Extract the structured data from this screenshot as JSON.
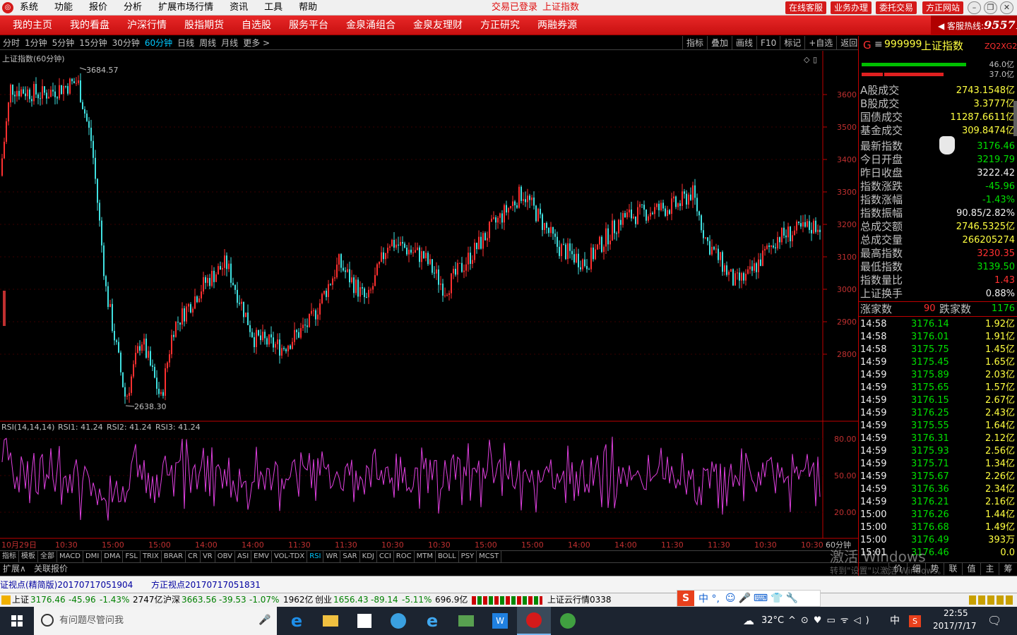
{
  "titlebar": {
    "menu": [
      "系统",
      "功能",
      "报价",
      "分析",
      "扩展市场行情",
      "资讯",
      "工具",
      "帮助"
    ],
    "login_status": "交易已登录",
    "current_view": "上证指数",
    "buttons": [
      "在线客服",
      "业务办理",
      "委托交易",
      "方正网站"
    ],
    "window_controls": [
      "minimize-icon",
      "restore-icon",
      "maximize-icon",
      "close-icon"
    ]
  },
  "nav": {
    "items": [
      "我的主页",
      "我的看盘",
      "沪深行情",
      "股指期货",
      "自选股",
      "服务平台",
      "金泉涌组合",
      "金泉友理财",
      "方正研究",
      "两融券源"
    ],
    "hotline_label": "客服热线:",
    "hotline_number": "95571"
  },
  "periodbar": {
    "periods": [
      "分时",
      "1分钟",
      "5分钟",
      "15分钟",
      "30分钟",
      "60分钟",
      "日线",
      "周线",
      "月线",
      "更多 >"
    ],
    "active": "60分钟",
    "tools": [
      "指标",
      "叠加",
      "画线",
      "F10",
      "标记",
      "+自选",
      "返回"
    ]
  },
  "main_chart": {
    "title": "上证指数(60分钟)",
    "high_label": "3684.57",
    "low_label": "2638.30",
    "y_ticks": [
      "3600",
      "3500",
      "3400",
      "3300",
      "3200",
      "3100",
      "3000",
      "2900",
      "2800"
    ]
  },
  "rsi": {
    "title": "RSI(14,14,14)",
    "rsi1": "RSI1: 41.24",
    "rsi2": "RSI2: 41.24",
    "rsi3": "RSI3: 41.24",
    "y_ticks": [
      "80.00",
      "50.00",
      "20.00"
    ]
  },
  "x_axis": {
    "labels": [
      "10月29日",
      "10:30",
      "15:00",
      "15:00",
      "14:00",
      "14:00",
      "11:30",
      "11:30",
      "10:30",
      "10:30",
      "15:00",
      "15:00",
      "14:00",
      "14:00",
      "11:30",
      "11:30",
      "10:30",
      "10:30"
    ],
    "unit": "60分钟"
  },
  "chart_data": {
    "type": "candlestick",
    "series": [
      {
        "name": "上证指数(60分钟)",
        "y_range": [
          2638.3,
          3684.57
        ],
        "last": 3176.46
      },
      {
        "name": "RSI1",
        "last": 41.24
      }
    ]
  },
  "indicator_tabs": [
    "指标",
    "模板",
    "全部",
    "MACD",
    "DMI",
    "DMA",
    "FSL",
    "TRIX",
    "BRAR",
    "CR",
    "VR",
    "OBV",
    "ASI",
    "EMV",
    "VOL-TDX",
    "RSI",
    "WR",
    "SAR",
    "KDJ",
    "CCI",
    "ROC",
    "MTM",
    "BOLL",
    "PSY",
    "MCST"
  ],
  "active_indicator": "RSI",
  "extbar": {
    "expand": "扩展∧",
    "related": "关联报价"
  },
  "right_panel": {
    "logo": "G",
    "code": "999999",
    "name": "上证指数",
    "tag": "ZQ2XG2",
    "bar_green_pct": "46.0亿",
    "bar_red_pct": "37.0亿",
    "turnover": [
      {
        "k": "A股成交",
        "v": "2743.1548亿"
      },
      {
        "k": "B股成交",
        "v": "3.3777亿"
      },
      {
        "k": "国债成交",
        "v": "11287.6611亿"
      },
      {
        "k": "基金成交",
        "v": "309.8474亿"
      }
    ],
    "quotes": [
      {
        "k": "最新指数",
        "v": "3176.46",
        "c": "green"
      },
      {
        "k": "今日开盘",
        "v": "3219.79",
        "c": "green"
      },
      {
        "k": "昨日收盘",
        "v": "3222.42",
        "c": "white"
      },
      {
        "k": "指数涨跌",
        "v": "-45.96",
        "c": "green"
      },
      {
        "k": "指数涨幅",
        "v": "-1.43%",
        "c": "green"
      },
      {
        "k": "指数振幅",
        "v": "90.85/2.82%",
        "c": "white"
      },
      {
        "k": "总成交额",
        "v": "2746.5325亿",
        "c": "yellow"
      },
      {
        "k": "总成交量",
        "v": "266205274",
        "c": "yellow"
      },
      {
        "k": "最高指数",
        "v": "3230.35",
        "c": "red"
      },
      {
        "k": "最低指数",
        "v": "3139.50",
        "c": "green"
      },
      {
        "k": "指数量比",
        "v": "1.43",
        "c": "red"
      },
      {
        "k": "上证换手",
        "v": "0.88%",
        "c": "white"
      }
    ],
    "advance_label": "涨家数",
    "advance": "90",
    "decline_label": "跌家数",
    "decline": "1176",
    "ticks": [
      [
        "14:58",
        "3176.14",
        "1.92亿"
      ],
      [
        "14:58",
        "3176.01",
        "1.91亿"
      ],
      [
        "14:58",
        "3175.75",
        "1.45亿"
      ],
      [
        "14:59",
        "3175.45",
        "1.65亿"
      ],
      [
        "14:59",
        "3175.89",
        "2.03亿"
      ],
      [
        "14:59",
        "3175.65",
        "1.57亿"
      ],
      [
        "14:59",
        "3176.15",
        "2.67亿"
      ],
      [
        "14:59",
        "3176.25",
        "2.43亿"
      ],
      [
        "14:59",
        "3175.55",
        "1.64亿"
      ],
      [
        "14:59",
        "3176.31",
        "2.12亿"
      ],
      [
        "14:59",
        "3175.93",
        "2.56亿"
      ],
      [
        "14:59",
        "3175.71",
        "1.34亿"
      ],
      [
        "14:59",
        "3175.67",
        "2.26亿"
      ],
      [
        "14:59",
        "3176.36",
        "2.34亿"
      ],
      [
        "14:59",
        "3176.21",
        "2.16亿"
      ],
      [
        "15:00",
        "3176.26",
        "1.44亿"
      ],
      [
        "15:00",
        "3176.68",
        "1.49亿"
      ],
      [
        "15:00",
        "3176.49",
        "393万"
      ],
      [
        "15:01",
        "3176.46",
        "0.0"
      ]
    ],
    "bottom_tabs": [
      "价",
      "细",
      "势",
      "联",
      "值",
      "主",
      "筹"
    ]
  },
  "newsbar": {
    "item1": "证视点(精简版)20170717051904",
    "item2": "方正视点20170717051831"
  },
  "statusbar": {
    "sh": {
      "name": "上证",
      "price": "3176.46",
      "chg": "-45.96",
      "pct": "-1.43%",
      "amt": "2747亿"
    },
    "sz": {
      "name": "沪深",
      "price": "3663.56",
      "chg": "-39.53",
      "pct": "-1.07%",
      "amt": "1962亿"
    },
    "cy": {
      "name": "创业",
      "price": "1656.43",
      "chg": "-89.14",
      "pct": "-5.11%",
      "amt": "696.9亿"
    },
    "cloud": "上证云行情0338"
  },
  "ime": {
    "label": "中 °,"
  },
  "taskbar": {
    "search_placeholder": "有问题尽管问我",
    "temperature": "32°C",
    "ime_lang": "中",
    "time": "22:55",
    "date": "2017/7/17"
  },
  "watermark": {
    "line1": "激活 Windows",
    "line2": "转到\"设置\"以激活 Windows。"
  },
  "colors": {
    "up": "#ff3030",
    "down": "#00e0e0",
    "rsi": "#e040e0",
    "brand_red": "#d41a1a"
  }
}
